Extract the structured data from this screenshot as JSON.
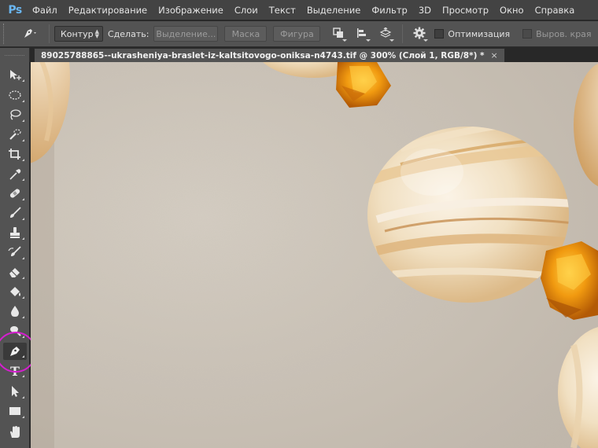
{
  "app": {
    "logo": "Ps"
  },
  "menu": [
    "Файл",
    "Редактирование",
    "Изображение",
    "Слои",
    "Текст",
    "Выделение",
    "Фильтр",
    "3D",
    "Просмотр",
    "Окно",
    "Справка"
  ],
  "options": {
    "tool_icon": "pen-icon",
    "mode_select": "Контур",
    "make_label": "Сделать:",
    "selection_button": "Выделение...",
    "mask_button": "Маска",
    "shape_button": "Фигура",
    "optimize_label": "Оптимизация",
    "align_edges_label": "Выров. края"
  },
  "document": {
    "tab_title": "89025788865--ukrasheniya-braslet-iz-kaltsitovogo-oniksa-n4743.tif @ 300% (Слой 1, RGB/8*) *",
    "close_glyph": "×"
  },
  "tools": [
    {
      "name": "move-tool",
      "icon": "move-icon"
    },
    {
      "name": "marquee-tool",
      "icon": "ellipse-marquee-icon"
    },
    {
      "name": "lasso-tool",
      "icon": "lasso-icon"
    },
    {
      "name": "quick-selection-tool",
      "icon": "quick-selection-icon"
    },
    {
      "name": "crop-tool",
      "icon": "crop-icon"
    },
    {
      "name": "eyedropper-tool",
      "icon": "eyedropper-icon"
    },
    {
      "name": "healing-brush-tool",
      "icon": "bandage-icon"
    },
    {
      "name": "brush-tool",
      "icon": "brush-icon"
    },
    {
      "name": "clone-stamp-tool",
      "icon": "stamp-icon"
    },
    {
      "name": "history-brush-tool",
      "icon": "history-brush-icon"
    },
    {
      "name": "eraser-tool",
      "icon": "eraser-icon"
    },
    {
      "name": "paint-bucket-tool",
      "icon": "bucket-icon"
    },
    {
      "name": "blur-tool",
      "icon": "drop-icon"
    },
    {
      "name": "dodge-tool",
      "icon": "dodge-icon"
    },
    {
      "name": "pen-tool",
      "icon": "pen-icon",
      "active": true
    },
    {
      "name": "type-tool",
      "icon": "type-icon",
      "glyph": "T"
    },
    {
      "name": "path-selection-tool",
      "icon": "arrow-icon"
    },
    {
      "name": "rectangle-tool",
      "icon": "rectangle-icon"
    },
    {
      "name": "hand-tool",
      "icon": "hand-icon"
    }
  ],
  "colors": {
    "highlight_circle": "#d61ed0",
    "amber_bead": "#e68a0a",
    "onyx_bead": "#f1e2c8",
    "background_texture": "#cfc7bc"
  }
}
